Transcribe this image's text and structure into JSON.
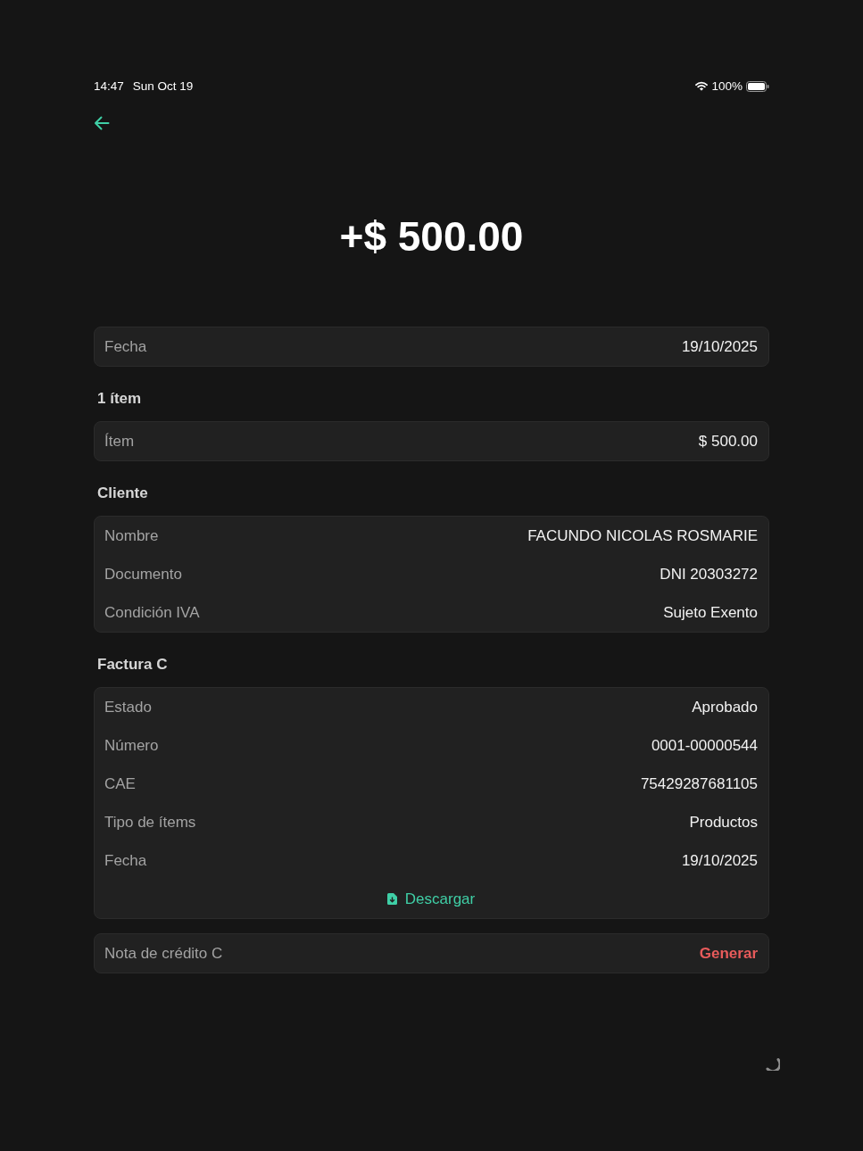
{
  "status_bar": {
    "time": "14:47",
    "date": "Sun Oct 19",
    "battery": "100%"
  },
  "amount": "+$ 500.00",
  "sections": [
    {
      "rows": [
        {
          "kind": "field",
          "label": "Fecha",
          "value": "19/10/2025"
        }
      ]
    },
    {
      "heading": "1 ítem",
      "rows": [
        {
          "kind": "field",
          "label": "Ítem",
          "value": "$ 500.00"
        }
      ]
    },
    {
      "heading": "Cliente",
      "rows": [
        {
          "kind": "field",
          "label": "Nombre",
          "value": "FACUNDO NICOLAS ROSMARIE"
        },
        {
          "kind": "field",
          "label": "Documento",
          "value": "DNI 20303272"
        },
        {
          "kind": "field",
          "label": "Condición IVA",
          "value": "Sujeto Exento"
        }
      ]
    },
    {
      "heading": "Factura C",
      "rows": [
        {
          "kind": "field",
          "label": "Estado",
          "value": "Aprobado"
        },
        {
          "kind": "field",
          "label": "Número",
          "value": "0001-00000544"
        },
        {
          "kind": "field",
          "label": "CAE",
          "value": "75429287681105"
        },
        {
          "kind": "field",
          "label": "Tipo de ítems",
          "value": "Productos"
        },
        {
          "kind": "field",
          "label": "Fecha",
          "value": "19/10/2025"
        },
        {
          "kind": "link",
          "label": "Descargar"
        }
      ]
    },
    {
      "rows": [
        {
          "kind": "action",
          "label": "Nota de crédito C",
          "action": "Generar"
        }
      ]
    }
  ]
}
